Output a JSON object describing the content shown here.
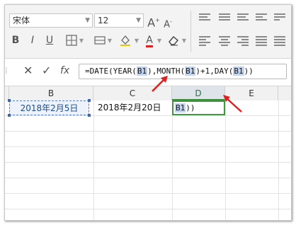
{
  "ribbon": {
    "font_name": "宋体",
    "font_size": "12",
    "grow_font_label": "A",
    "shrink_font_label": "A",
    "bold_label": "B",
    "italic_label": "I",
    "underline_label": "U",
    "font_color_label": "A"
  },
  "formula_bar": {
    "cancel_icon": "close-icon",
    "confirm_icon": "check-icon",
    "fx_label": "fx",
    "formula_parts": [
      "=DATE(YEAR(",
      "B1",
      "),MONTH(",
      "B1",
      ")+1,DAY(",
      "B1",
      "))"
    ]
  },
  "columns": [
    "B",
    "C",
    "D",
    "E"
  ],
  "selected_column": "D",
  "cells": {
    "B1": "2018年2月5日",
    "C1": "2018年2月20日",
    "D1_ref": "B1",
    "D1_tail": "))"
  },
  "colors": {
    "reference_highlight": "#c5d4ee",
    "active_cell_border": "#3f9a3f",
    "arrow": "#e02020"
  }
}
